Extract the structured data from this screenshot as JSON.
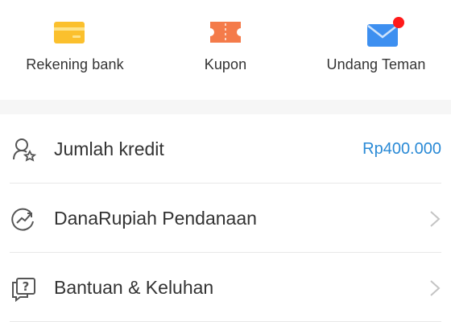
{
  "shortcuts": [
    {
      "label": "Rekening bank",
      "icon": "bank-card-icon",
      "color": "#fbc02d"
    },
    {
      "label": "Kupon",
      "icon": "coupon-ticket-icon",
      "color": "#f47b4a"
    },
    {
      "label": "Undang Teman",
      "icon": "envelope-icon",
      "color": "#3d8ff0",
      "badge_color": "#ff1a1a"
    }
  ],
  "menu": [
    {
      "label": "Jumlah kredit",
      "value": "Rp400.000",
      "icon": "credit-badge-icon"
    },
    {
      "label": "DanaRupiah Pendanaan",
      "icon": "trend-chart-icon"
    },
    {
      "label": "Bantuan & Keluhan",
      "icon": "help-chat-icon"
    }
  ],
  "colors": {
    "accent": "#2a8ad6",
    "divider": "#e8e8e8",
    "section_gap": "#f6f6f6",
    "pointer": "#d32f2f"
  }
}
